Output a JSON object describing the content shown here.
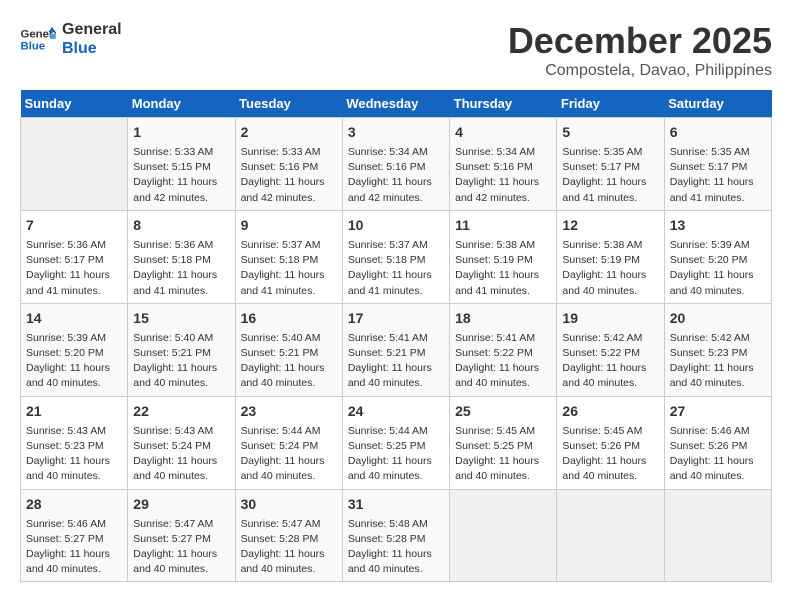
{
  "header": {
    "logo_line1": "General",
    "logo_line2": "Blue",
    "month": "December 2025",
    "location": "Compostela, Davao, Philippines"
  },
  "days_of_week": [
    "Sunday",
    "Monday",
    "Tuesday",
    "Wednesday",
    "Thursday",
    "Friday",
    "Saturday"
  ],
  "weeks": [
    [
      {
        "day": "",
        "empty": true
      },
      {
        "day": "1",
        "sunrise": "5:33 AM",
        "sunset": "5:15 PM",
        "daylight": "11 hours and 42 minutes."
      },
      {
        "day": "2",
        "sunrise": "5:33 AM",
        "sunset": "5:16 PM",
        "daylight": "11 hours and 42 minutes."
      },
      {
        "day": "3",
        "sunrise": "5:34 AM",
        "sunset": "5:16 PM",
        "daylight": "11 hours and 42 minutes."
      },
      {
        "day": "4",
        "sunrise": "5:34 AM",
        "sunset": "5:16 PM",
        "daylight": "11 hours and 42 minutes."
      },
      {
        "day": "5",
        "sunrise": "5:35 AM",
        "sunset": "5:17 PM",
        "daylight": "11 hours and 41 minutes."
      },
      {
        "day": "6",
        "sunrise": "5:35 AM",
        "sunset": "5:17 PM",
        "daylight": "11 hours and 41 minutes."
      }
    ],
    [
      {
        "day": "7",
        "sunrise": "5:36 AM",
        "sunset": "5:17 PM",
        "daylight": "11 hours and 41 minutes."
      },
      {
        "day": "8",
        "sunrise": "5:36 AM",
        "sunset": "5:18 PM",
        "daylight": "11 hours and 41 minutes."
      },
      {
        "day": "9",
        "sunrise": "5:37 AM",
        "sunset": "5:18 PM",
        "daylight": "11 hours and 41 minutes."
      },
      {
        "day": "10",
        "sunrise": "5:37 AM",
        "sunset": "5:18 PM",
        "daylight": "11 hours and 41 minutes."
      },
      {
        "day": "11",
        "sunrise": "5:38 AM",
        "sunset": "5:19 PM",
        "daylight": "11 hours and 41 minutes."
      },
      {
        "day": "12",
        "sunrise": "5:38 AM",
        "sunset": "5:19 PM",
        "daylight": "11 hours and 40 minutes."
      },
      {
        "day": "13",
        "sunrise": "5:39 AM",
        "sunset": "5:20 PM",
        "daylight": "11 hours and 40 minutes."
      }
    ],
    [
      {
        "day": "14",
        "sunrise": "5:39 AM",
        "sunset": "5:20 PM",
        "daylight": "11 hours and 40 minutes."
      },
      {
        "day": "15",
        "sunrise": "5:40 AM",
        "sunset": "5:21 PM",
        "daylight": "11 hours and 40 minutes."
      },
      {
        "day": "16",
        "sunrise": "5:40 AM",
        "sunset": "5:21 PM",
        "daylight": "11 hours and 40 minutes."
      },
      {
        "day": "17",
        "sunrise": "5:41 AM",
        "sunset": "5:21 PM",
        "daylight": "11 hours and 40 minutes."
      },
      {
        "day": "18",
        "sunrise": "5:41 AM",
        "sunset": "5:22 PM",
        "daylight": "11 hours and 40 minutes."
      },
      {
        "day": "19",
        "sunrise": "5:42 AM",
        "sunset": "5:22 PM",
        "daylight": "11 hours and 40 minutes."
      },
      {
        "day": "20",
        "sunrise": "5:42 AM",
        "sunset": "5:23 PM",
        "daylight": "11 hours and 40 minutes."
      }
    ],
    [
      {
        "day": "21",
        "sunrise": "5:43 AM",
        "sunset": "5:23 PM",
        "daylight": "11 hours and 40 minutes."
      },
      {
        "day": "22",
        "sunrise": "5:43 AM",
        "sunset": "5:24 PM",
        "daylight": "11 hours and 40 minutes."
      },
      {
        "day": "23",
        "sunrise": "5:44 AM",
        "sunset": "5:24 PM",
        "daylight": "11 hours and 40 minutes."
      },
      {
        "day": "24",
        "sunrise": "5:44 AM",
        "sunset": "5:25 PM",
        "daylight": "11 hours and 40 minutes."
      },
      {
        "day": "25",
        "sunrise": "5:45 AM",
        "sunset": "5:25 PM",
        "daylight": "11 hours and 40 minutes."
      },
      {
        "day": "26",
        "sunrise": "5:45 AM",
        "sunset": "5:26 PM",
        "daylight": "11 hours and 40 minutes."
      },
      {
        "day": "27",
        "sunrise": "5:46 AM",
        "sunset": "5:26 PM",
        "daylight": "11 hours and 40 minutes."
      }
    ],
    [
      {
        "day": "28",
        "sunrise": "5:46 AM",
        "sunset": "5:27 PM",
        "daylight": "11 hours and 40 minutes."
      },
      {
        "day": "29",
        "sunrise": "5:47 AM",
        "sunset": "5:27 PM",
        "daylight": "11 hours and 40 minutes."
      },
      {
        "day": "30",
        "sunrise": "5:47 AM",
        "sunset": "5:28 PM",
        "daylight": "11 hours and 40 minutes."
      },
      {
        "day": "31",
        "sunrise": "5:48 AM",
        "sunset": "5:28 PM",
        "daylight": "11 hours and 40 minutes."
      },
      {
        "day": "",
        "empty": true
      },
      {
        "day": "",
        "empty": true
      },
      {
        "day": "",
        "empty": true
      }
    ]
  ],
  "labels": {
    "sunrise_prefix": "Sunrise: ",
    "sunset_prefix": "Sunset: ",
    "daylight_prefix": "Daylight: "
  }
}
